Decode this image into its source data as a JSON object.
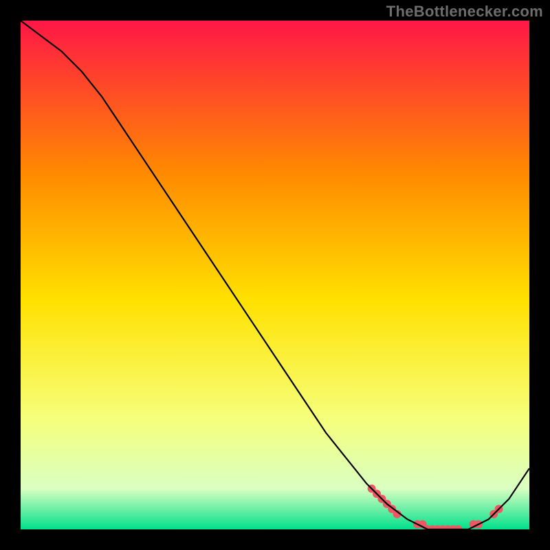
{
  "watermark": "TheBottlenecker.com",
  "chart_data": {
    "type": "line",
    "title": "",
    "xlabel": "",
    "ylabel": "",
    "xlim": [
      0,
      100
    ],
    "ylim": [
      0,
      100
    ],
    "background_gradient": {
      "top": "#ff1746",
      "upper_mid": "#ff8a00",
      "mid": "#ffe100",
      "lower_mid": "#f6ff7a",
      "low": "#d9ffc2",
      "bottom": "#00e08a"
    },
    "series": [
      {
        "name": "bottleneck-curve",
        "color": "#000000",
        "x": [
          0,
          4,
          8,
          12,
          16,
          20,
          24,
          28,
          32,
          36,
          40,
          44,
          48,
          52,
          56,
          60,
          64,
          68,
          72,
          76,
          80,
          84,
          88,
          92,
          96,
          100
        ],
        "y": [
          100,
          97,
          94,
          90,
          85,
          79,
          73,
          67,
          61,
          55,
          49,
          43,
          37,
          31,
          25,
          19,
          14,
          9,
          5,
          2,
          0,
          0,
          0,
          2,
          6,
          12
        ]
      }
    ],
    "markers": {
      "name": "highlight-points",
      "color": "#ef5763",
      "radius_px": 6,
      "points": [
        {
          "x": 69,
          "y": 8
        },
        {
          "x": 70,
          "y": 7
        },
        {
          "x": 71,
          "y": 6
        },
        {
          "x": 72,
          "y": 5
        },
        {
          "x": 73,
          "y": 4
        },
        {
          "x": 74,
          "y": 3
        },
        {
          "x": 78,
          "y": 1
        },
        {
          "x": 79,
          "y": 1
        },
        {
          "x": 80,
          "y": 0
        },
        {
          "x": 81,
          "y": 0
        },
        {
          "x": 82,
          "y": 0
        },
        {
          "x": 83,
          "y": 0
        },
        {
          "x": 84,
          "y": 0
        },
        {
          "x": 85,
          "y": 0
        },
        {
          "x": 86,
          "y": 0
        },
        {
          "x": 89,
          "y": 1
        },
        {
          "x": 90,
          "y": 1
        },
        {
          "x": 93,
          "y": 3
        },
        {
          "x": 94,
          "y": 4
        }
      ]
    }
  }
}
